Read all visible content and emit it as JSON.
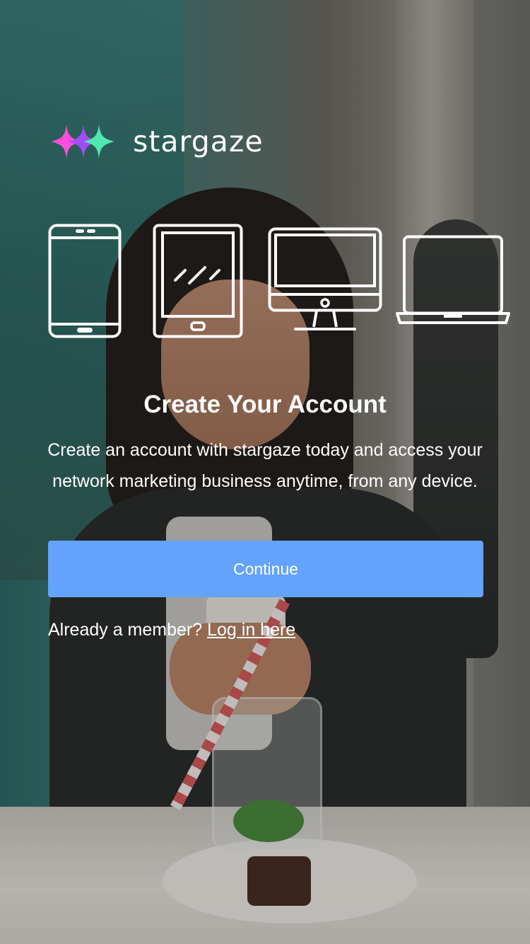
{
  "brand": {
    "name": "stargaze",
    "logo_colors": [
      "#ff4fd8",
      "#a54cff",
      "#3fe0b6",
      "#6cf2a5"
    ]
  },
  "devices": {
    "icons": [
      "smartphone-icon",
      "tablet-icon",
      "desktop-monitor-icon",
      "laptop-icon"
    ],
    "stroke_color": "#ffffff"
  },
  "content": {
    "title": "Create Your Account",
    "description_line1": "Create an account with stargaze today and access your",
    "description_line2": "network marketing business anytime, from any device."
  },
  "actions": {
    "continue_label": "Continue",
    "continue_color": "#63a3fd",
    "member_prompt": "Already a member? ",
    "login_link": "Log in here"
  }
}
